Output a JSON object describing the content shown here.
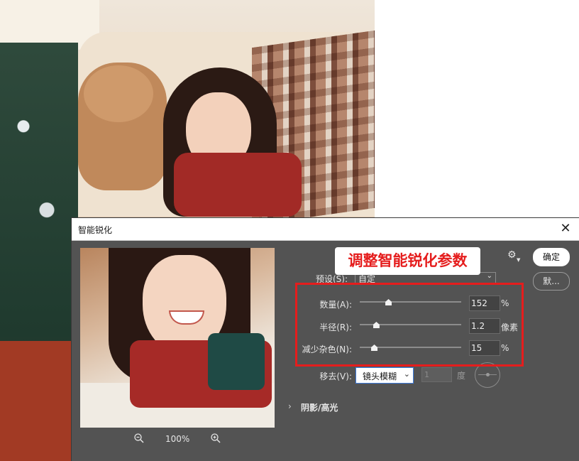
{
  "dialog": {
    "title": "智能锐化",
    "close_glyph": "✕",
    "preview": {
      "zoom_level": "100%"
    },
    "preset": {
      "label": "预设(S):",
      "value": "自定"
    },
    "controls": [
      {
        "label": "数量(A):",
        "value": "152",
        "unit": "%",
        "level": 0.28
      },
      {
        "label": "半径(R):",
        "value": "1.2",
        "unit": "像素",
        "level": 0.16
      },
      {
        "label": "减少杂色(N):",
        "value": "15",
        "unit": "%",
        "level": 0.14
      }
    ],
    "remove": {
      "label": "移去(V):",
      "value": "镜头模糊",
      "angle_value": "1",
      "angle_unit": "度"
    },
    "shadows_highlights": {
      "label": "阴影/高光"
    },
    "buttons": {
      "ok": "确定",
      "default": "默..."
    }
  },
  "annotation": {
    "callout_text": "调整智能锐化参数",
    "color": "#e51d1d"
  },
  "icons": [
    "close-icon",
    "zoom-out-icon",
    "zoom-in-icon",
    "gear-icon",
    "chevron-down-icon",
    "chevron-right-icon",
    "angle-dial-icon"
  ]
}
